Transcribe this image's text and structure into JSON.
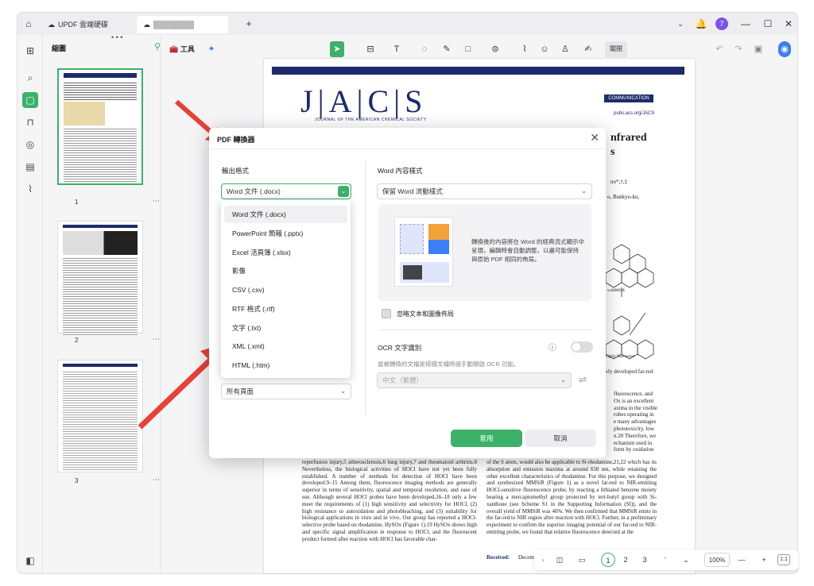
{
  "tabs": [
    {
      "icon": "cloud-icon",
      "label": "UPDF 雲端硬碟"
    },
    {
      "icon": "cloud-icon",
      "label": "████████"
    }
  ],
  "window": {
    "notif_count": "7"
  },
  "sidebar": {
    "title": "縮圖",
    "pages": [
      "1",
      "2",
      "3"
    ]
  },
  "toolbar": {
    "tools_label": "工具",
    "close_label": "關閉"
  },
  "document": {
    "journal_logo": "J|A|C|S",
    "journal_sub": "JOURNAL OF THE AMERICAN CHEMICAL SOCIETY",
    "comm_label": "COMMUNICATION",
    "pubs_label": "pubs.acs.org/JACS",
    "title_frag": "nfrared",
    "title_frag2": "s",
    "author_frag": "no*,†,‡",
    "affil_frag": "o, Bunkyo-ku,",
    "body_left": "reperfusion injury,5 atherosclerosis,6 lung injury,7 and rheumatoid arthritis.8 Nevertheless, the biological activities of HOCl have not yet been fully established. A number of methods for detection of HOCl have been developed.9–15 Among them, fluorescence imaging methods are generally superior in terms of sensitivity, spatial and temporal resolution, and ease of use. Although several HOCl probes have been developed,16–18 only a few meet the requirements of (1) high sensitivity and selectivity for HOCl, (2) high resistance to autoxidation and photobleaching, and (3) suitability for biological applications in vitro and in vivo. Our group has reported a HOCl-selective probe based on rhodamine, HySOx (Figure 1).19 HySOx shows high and specific signal amplification in response to HOCl, and the fluorescent product formed after reaction with HOCl has favorable char-",
    "body_right": "of the S atom, would also be applicable to Si-rhodamine,21,22 which has its absorption and emission maxima at around 650 nm, while retaining the other excellent characteristics of rhodamine. For this purpose, we designed and synthesized MMSiR (Figure 1) as a novel far-red to NIR-emitting HOCl-sensitive fluorescence probe, by reacting a lithiated benzene moiety bearing a mercaptomethyl group protected by tert-butyl group with Si-xanthone (see Scheme S1 in the Supporting Information (SI)), and the overall yield of MMSiR was 46%. We then confirmed that MMSiR emits in the far-red to NIR region after reaction with HOCl. Further, in a preliminary experiment to confirm the superior imaging potential of our far-red to NIR-emitting probe, we found that relative fluorescence detected at the",
    "right_frags": [
      "fluorescence, and",
      "Ox is an excellent",
      "axima in the visible",
      "robes operating in",
      "e many advantages",
      "phototoxicity, low",
      "n.20 Therefore, we",
      "echanism used in",
      "form by oxidation"
    ],
    "fig_labels": [
      "wsMMSiR",
      "highly fluorescent",
      "wly developed far-red"
    ],
    "received": "Received:",
    "received_frag": "Decem"
  },
  "dialog": {
    "title": "PDF 轉換器",
    "output_label": "輸出格式",
    "output_value": "Word 文件 (.docx)",
    "page_range_value": "所有頁面",
    "word_content_label": "Word 內容樣式",
    "word_content_value": "保留 Word 流動樣式",
    "preview_desc": "轉換後的內容將在 Word 的經典流式顯示中呈現，編輯時會自動調整，以盡可能保持與原始 PDF 相同的佈局。",
    "ignore_label": "忽略文本和圖像佈局",
    "ocr_label": "OCR 文字識別",
    "ocr_desc": "當被轉換的文檔是掃描文檔時請手動開啟 OCR 功能。",
    "ocr_lang": "中文（繁體）",
    "apply_label": "套用",
    "cancel_label": "取消",
    "formats": [
      "Word 文件 (.docx)",
      "PowerPoint 簡報 (.pptx)",
      "Excel 活頁簿 (.xlsx)",
      "影像",
      "CSV (.csv)",
      "RTF 格式 (.rtf)",
      "文字 (.txt)",
      "XML (.xml)",
      "HTML (.htm)"
    ]
  },
  "bottombar": {
    "pages": [
      "1",
      "2",
      "3"
    ],
    "zoom": "100%"
  },
  "colors": {
    "accent": "#3bb16a",
    "arrow": "#e8403a",
    "journal": "#1d2b6b"
  }
}
